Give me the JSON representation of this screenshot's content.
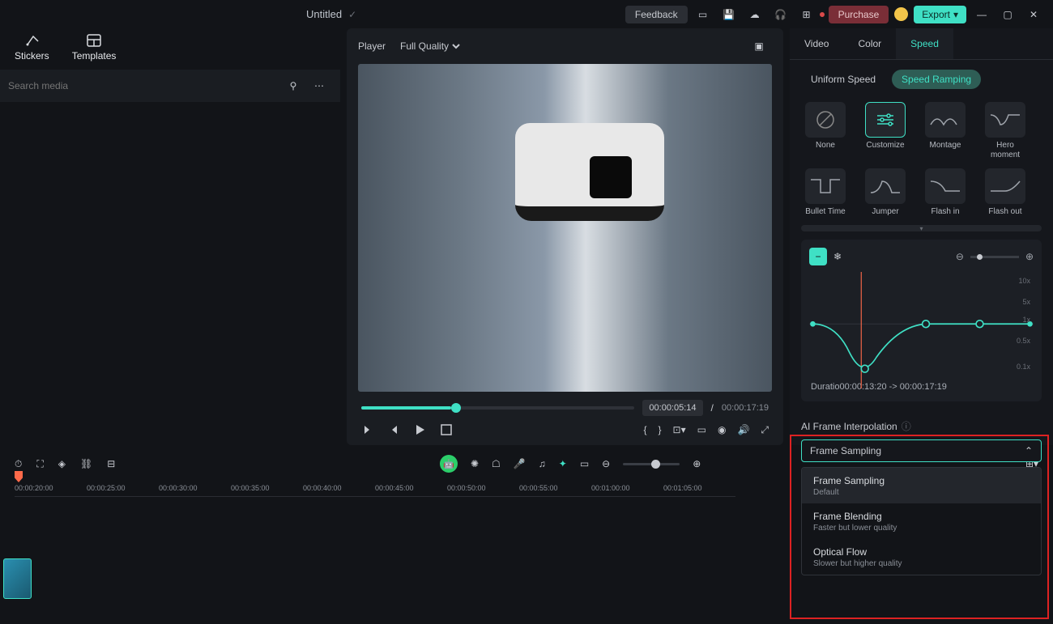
{
  "titlebar": {
    "title": "Untitled",
    "feedback": "Feedback",
    "purchase": "Purchase",
    "export": "Export"
  },
  "left": {
    "tabs": [
      "Stickers",
      "Templates"
    ],
    "search_placeholder": "Search media"
  },
  "player": {
    "label": "Player",
    "quality": "Full Quality",
    "current": "00:00:05:14",
    "sep": "/",
    "total": "00:00:17:19"
  },
  "right": {
    "tabs": [
      "Video",
      "Color",
      "Speed"
    ],
    "active_tab": "Speed",
    "subtabs": [
      "Uniform Speed",
      "Speed Ramping"
    ],
    "active_sub": "Speed Ramping",
    "presets": [
      "None",
      "Customize",
      "Montage",
      "Hero moment",
      "Bullet Time",
      "Jumper",
      "Flash in",
      "Flash out"
    ],
    "ylabels": [
      "10x",
      "5x",
      "1x",
      "0.5x",
      "0.1x"
    ],
    "duration": "Duratio00:00:13:20 -> 00:00:17:19"
  },
  "ai": {
    "title": "AI Frame Interpolation",
    "selected": "Frame Sampling",
    "options": [
      {
        "n": "Frame Sampling",
        "s": "Default"
      },
      {
        "n": "Frame Blending",
        "s": "Faster but lower quality"
      },
      {
        "n": "Optical Flow",
        "s": "Slower but higher quality"
      }
    ]
  },
  "timeline": {
    "marks": [
      "00:00:20:00",
      "00:00:25:00",
      "00:00:30:00",
      "00:00:35:00",
      "00:00:40:00",
      "00:00:45:00",
      "00:00:50:00",
      "00:00:55:00",
      "00:01:00:00",
      "00:01:05:00"
    ]
  }
}
